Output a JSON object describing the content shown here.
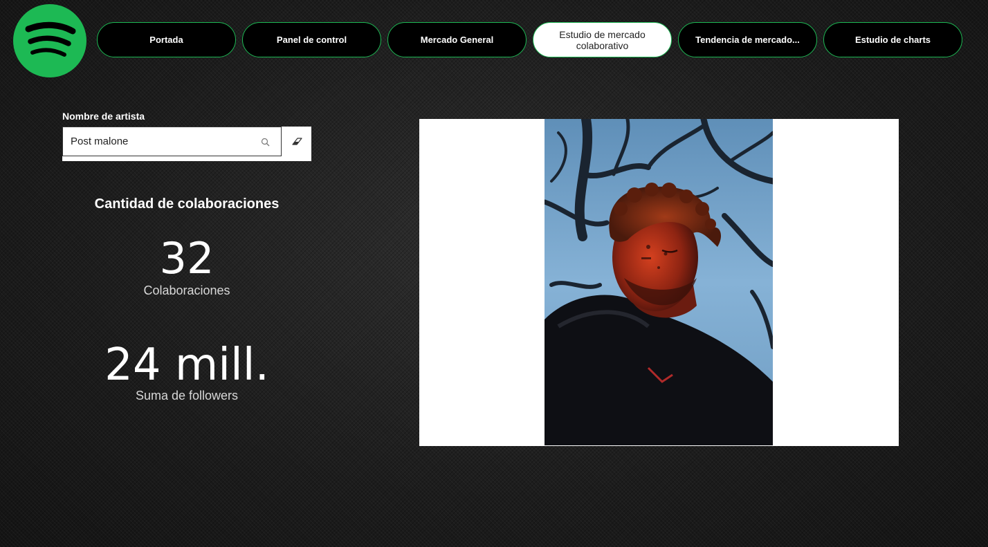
{
  "app": {
    "logo_icon": "spotify-logo-icon",
    "accent_color": "#1db954"
  },
  "nav": {
    "tabs": [
      {
        "label": "Portada"
      },
      {
        "label": "Panel de control"
      },
      {
        "label": "Mercado General"
      },
      {
        "label": "Estudio de mercado colaborativo",
        "active": true
      },
      {
        "label": "Tendencia de mercado..."
      },
      {
        "label": "Estudio de charts"
      }
    ]
  },
  "slicer": {
    "label": "Nombre de artista",
    "value": "Post malone",
    "search_icon": "search-icon",
    "erase_icon": "eraser-icon"
  },
  "kpis": {
    "section_title": "Cantidad de colaboraciones",
    "collaborations": {
      "value": "32",
      "label": "Colaboraciones"
    },
    "followers": {
      "value": "24 mill.",
      "label": "Suma de followers"
    }
  },
  "artist_image": {
    "subject": "artist-photo"
  }
}
